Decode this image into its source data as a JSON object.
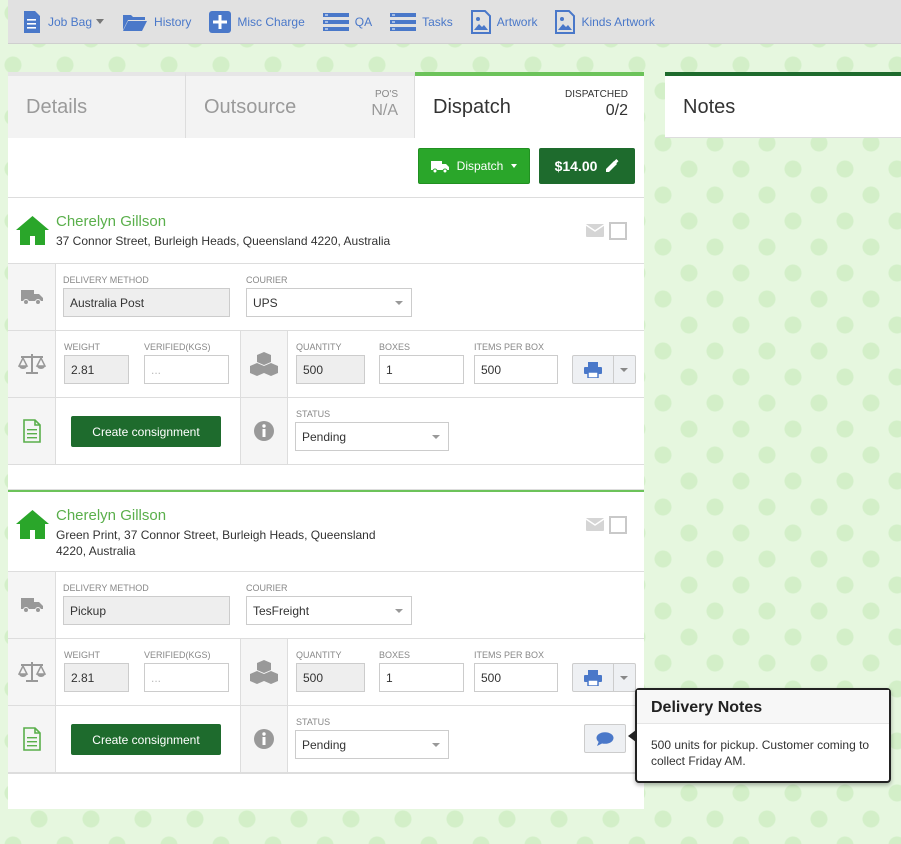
{
  "toolbar": {
    "items": [
      {
        "label": "Job Bag",
        "icon": "document-icon"
      },
      {
        "label": "History",
        "icon": "folder-icon"
      },
      {
        "label": "Misc Charge",
        "icon": "plus-icon"
      },
      {
        "label": "QA",
        "icon": "list-icon"
      },
      {
        "label": "Tasks",
        "icon": "list-icon"
      },
      {
        "label": "Artwork",
        "icon": "image-icon"
      },
      {
        "label": "Kinds Artwork",
        "icon": "image-icon"
      }
    ]
  },
  "tabs": {
    "details": "Details",
    "outsource": "Outsource",
    "outsource_po_label": "PO'S",
    "outsource_po_value": "N/A",
    "dispatch": "Dispatch",
    "dispatched_label": "DISPATCHED",
    "dispatched_value": "0/2"
  },
  "actions": {
    "dispatch_button": "Dispatch",
    "price_button": "$14.00"
  },
  "dispatches": [
    {
      "name": "Cherelyn Gillson",
      "address": "37 Connor Street, Burleigh Heads, Queensland 4220, Australia",
      "delivery_method_label": "DELIVERY METHOD",
      "delivery_method": "Australia Post",
      "courier_label": "COURIER",
      "courier": "UPS",
      "weight_label": "WEIGHT",
      "weight": "2.81",
      "verified_label": "VERIFIED(KGS)",
      "verified_placeholder": "...",
      "quantity_label": "QUANTITY",
      "quantity": "500",
      "boxes_label": "BOXES",
      "boxes": "1",
      "items_per_box_label": "ITEMS PER BOX",
      "items_per_box": "500",
      "consignment_button": "Create consignment",
      "status_label": "STATUS",
      "status": "Pending"
    },
    {
      "name": "Cherelyn Gillson",
      "address": "Green Print, 37 Connor Street, Burleigh Heads, Queensland 4220, Australia",
      "delivery_method_label": "DELIVERY METHOD",
      "delivery_method": "Pickup",
      "courier_label": "COURIER",
      "courier": "TesFreight",
      "weight_label": "WEIGHT",
      "weight": "2.81",
      "verified_label": "VERIFIED(KGS)",
      "verified_placeholder": "...",
      "quantity_label": "QUANTITY",
      "quantity": "500",
      "boxes_label": "BOXES",
      "boxes": "1",
      "items_per_box_label": "ITEMS PER BOX",
      "items_per_box": "500",
      "consignment_button": "Create consignment",
      "status_label": "STATUS",
      "status": "Pending"
    }
  ],
  "popover": {
    "title": "Delivery Notes",
    "body": "500 units for pickup. Customer coming to collect Friday AM."
  },
  "notes": {
    "title": "Notes"
  },
  "colors": {
    "accent_green": "#2aa62a",
    "dark_green": "#1e6b2d",
    "name_green": "#5aaf4b",
    "toolbar_blue": "#4a78c9"
  }
}
